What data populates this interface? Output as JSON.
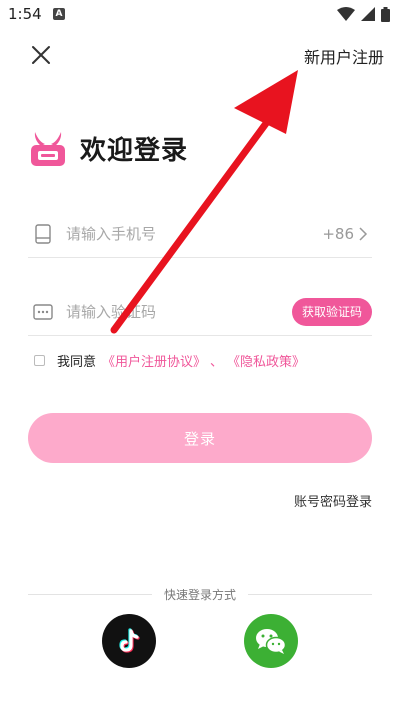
{
  "status_bar": {
    "time": "1:54",
    "notification_letter": "A"
  },
  "header": {
    "register_label": "新用户注册"
  },
  "brand": {
    "title": "欢迎登录",
    "color": "#f0579a"
  },
  "phone_field": {
    "placeholder": "请输入手机号",
    "value": "",
    "country_code": "+86"
  },
  "code_field": {
    "placeholder": "请输入验证码",
    "value": "",
    "get_code_label": "获取验证码"
  },
  "agreement": {
    "prefix": "我同意",
    "user_agreement": "《用户注册协议》",
    "separator": "、",
    "privacy_policy": "《隐私政策》",
    "checked": false
  },
  "login": {
    "button_label": "登录",
    "password_login_label": "账号密码登录"
  },
  "quick_login": {
    "label": "快速登录方式",
    "methods": [
      "tiktok-icon",
      "wechat-icon"
    ]
  },
  "colors": {
    "accent": "#f0579a",
    "login_button": "#fdaacb",
    "arrow": "#e8131f",
    "wechat": "#3cb034"
  }
}
